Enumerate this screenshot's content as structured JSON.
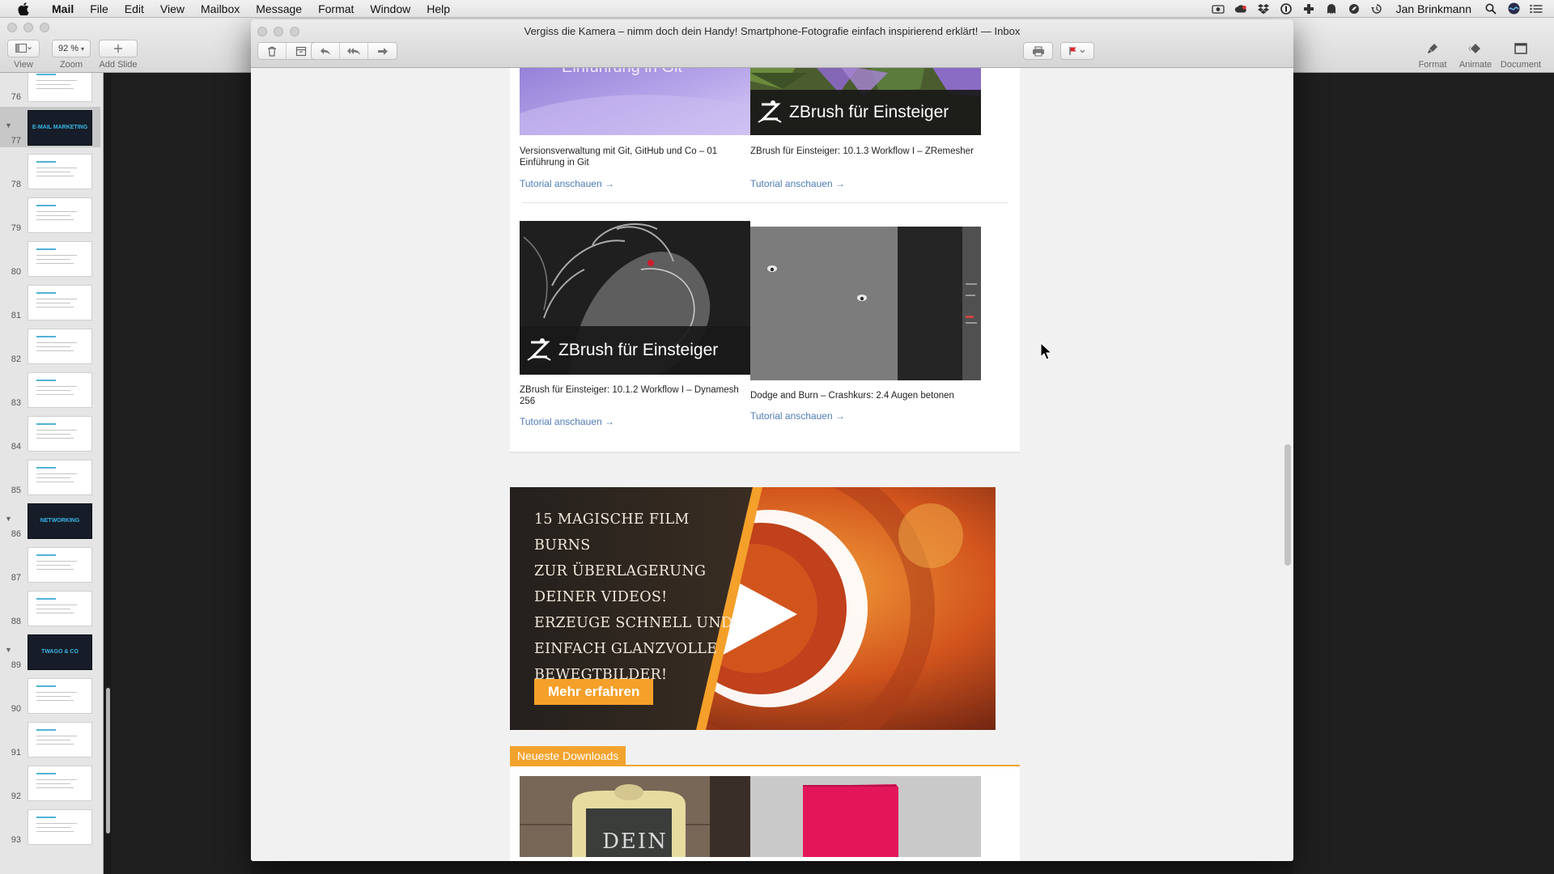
{
  "menubar": {
    "app": "Mail",
    "items": [
      "File",
      "Edit",
      "View",
      "Mailbox",
      "Message",
      "Format",
      "Window",
      "Help"
    ],
    "user": "Jan Brinkmann",
    "tray_icons": [
      "camera-icon",
      "creative-cloud-icon",
      "dropbox-icon",
      "onepassword-icon",
      "plus-icon",
      "cloud-icon",
      "leaf-icon",
      "time-machine-icon"
    ]
  },
  "keynote": {
    "zoom_value": "92 %",
    "tools": {
      "view": "View",
      "zoom": "Zoom",
      "add_slide": "Add Slide",
      "format": "Format",
      "animate": "Animate",
      "document": "Document"
    },
    "slides": [
      {
        "num": "76",
        "kind": "light"
      },
      {
        "num": "77",
        "kind": "dark",
        "label": "E-MAIL MARKETING",
        "selected": true
      },
      {
        "num": "78",
        "kind": "light"
      },
      {
        "num": "79",
        "kind": "light"
      },
      {
        "num": "80",
        "kind": "light"
      },
      {
        "num": "81",
        "kind": "light"
      },
      {
        "num": "82",
        "kind": "light"
      },
      {
        "num": "83",
        "kind": "light"
      },
      {
        "num": "84",
        "kind": "light"
      },
      {
        "num": "85",
        "kind": "light"
      },
      {
        "num": "86",
        "kind": "dark",
        "label": "NETWORKING"
      },
      {
        "num": "87",
        "kind": "light"
      },
      {
        "num": "88",
        "kind": "light"
      },
      {
        "num": "89",
        "kind": "dark",
        "label": "TWAGO & CO"
      },
      {
        "num": "90",
        "kind": "light"
      },
      {
        "num": "91",
        "kind": "light"
      },
      {
        "num": "92",
        "kind": "light"
      },
      {
        "num": "93",
        "kind": "light"
      }
    ]
  },
  "mail": {
    "window_title": "Vergiss die Kamera – nimm doch dein Handy! Smartphone-Fotografie einfach inspirierend erklärt! — Inbox",
    "cards": [
      {
        "image_text": "Einführung in Git",
        "title": "Versionsverwaltung mit Git, GitHub und Co – 01 Einführung in Git",
        "link": "Tutorial anschauen →"
      },
      {
        "image_text": "ZBrush für Einsteiger",
        "title": "ZBrush für Einsteiger: 10.1.3 Workflow I – ZRemesher",
        "link": "Tutorial anschauen →"
      },
      {
        "image_text": "ZBrush für Einsteiger",
        "title": "ZBrush für Einsteiger: 10.1.2 Workflow I – Dynamesh 256",
        "link": "Tutorial anschauen →"
      },
      {
        "title": "Dodge and Burn – Crashkurs: 2.4 Augen betonen",
        "link": "Tutorial anschauen →"
      }
    ],
    "banner": {
      "lines": [
        "15 MAGISCHE FILM BURNS",
        "ZUR ÜBERLAGERUNG",
        "DEINER VIDEOS!",
        "ERZEUGE SCHNELL UND",
        "EINFACH GLANZVOLLE",
        "BEWEGTBILDER!"
      ],
      "cta": "Mehr erfahren"
    },
    "downloads": {
      "header": "Neueste Downloads",
      "sign_text": "DEIN"
    },
    "colors": {
      "accent": "#f2a32d",
      "link": "#4f7bb3"
    }
  }
}
